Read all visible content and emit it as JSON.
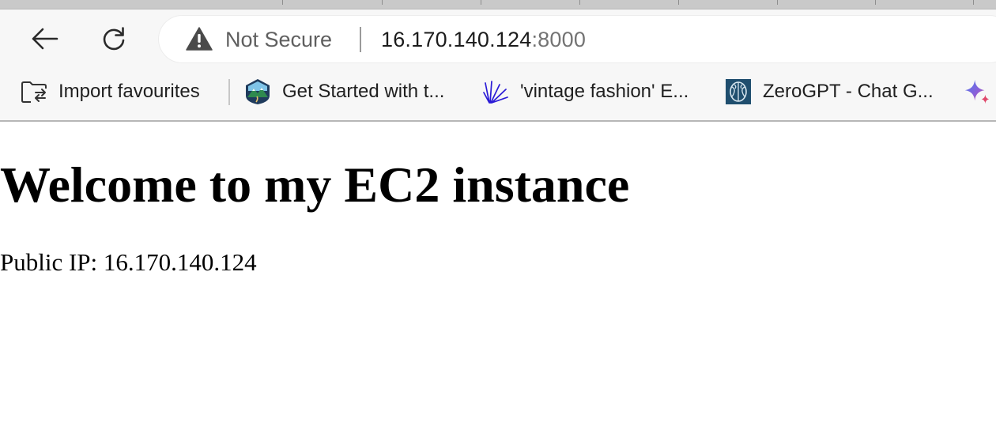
{
  "address_bar": {
    "security_label": "Not Secure",
    "url_host": "16.170.140.124",
    "url_port": ":8000"
  },
  "bookmarks": [
    {
      "label": "Import favourites",
      "icon": "import-folder-icon"
    },
    {
      "label": "Get Started with t...",
      "icon": "mountain-badge-icon"
    },
    {
      "label": "'vintage fashion' E...",
      "icon": "blue-scribble-icon"
    },
    {
      "label": "ZeroGPT - Chat G...",
      "icon": "brain-icon"
    },
    {
      "label": "",
      "icon": "sparkle-icon"
    }
  ],
  "page": {
    "heading": "Welcome to my EC2 instance",
    "ip_text": "Public IP: 16.170.140.124"
  },
  "colors": {
    "chrome_background": "#f7f7f7",
    "warning_icon": "#4a4a4a",
    "scribble_blue": "#2b1bd6",
    "brain_tile": "#1f4e6e"
  }
}
